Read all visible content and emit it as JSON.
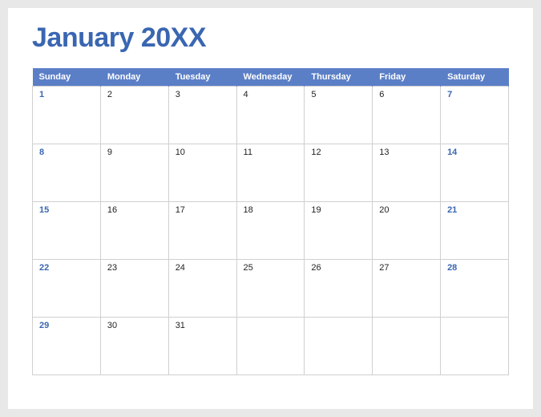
{
  "title": "January 20XX",
  "day_headers": [
    "Sunday",
    "Monday",
    "Tuesday",
    "Wednesday",
    "Thursday",
    "Friday",
    "Saturday"
  ],
  "weeks": [
    [
      {
        "n": "1",
        "weekend": true
      },
      {
        "n": "2",
        "weekend": false
      },
      {
        "n": "3",
        "weekend": false
      },
      {
        "n": "4",
        "weekend": false
      },
      {
        "n": "5",
        "weekend": false
      },
      {
        "n": "6",
        "weekend": false
      },
      {
        "n": "7",
        "weekend": true
      }
    ],
    [
      {
        "n": "8",
        "weekend": true
      },
      {
        "n": "9",
        "weekend": false
      },
      {
        "n": "10",
        "weekend": false
      },
      {
        "n": "11",
        "weekend": false
      },
      {
        "n": "12",
        "weekend": false
      },
      {
        "n": "13",
        "weekend": false
      },
      {
        "n": "14",
        "weekend": true
      }
    ],
    [
      {
        "n": "15",
        "weekend": true
      },
      {
        "n": "16",
        "weekend": false
      },
      {
        "n": "17",
        "weekend": false
      },
      {
        "n": "18",
        "weekend": false
      },
      {
        "n": "19",
        "weekend": false
      },
      {
        "n": "20",
        "weekend": false
      },
      {
        "n": "21",
        "weekend": true
      }
    ],
    [
      {
        "n": "22",
        "weekend": true
      },
      {
        "n": "23",
        "weekend": false
      },
      {
        "n": "24",
        "weekend": false
      },
      {
        "n": "25",
        "weekend": false
      },
      {
        "n": "26",
        "weekend": false
      },
      {
        "n": "27",
        "weekend": false
      },
      {
        "n": "28",
        "weekend": true
      }
    ],
    [
      {
        "n": "29",
        "weekend": true
      },
      {
        "n": "30",
        "weekend": false
      },
      {
        "n": "31",
        "weekend": false
      },
      {
        "n": "",
        "weekend": false
      },
      {
        "n": "",
        "weekend": false
      },
      {
        "n": "",
        "weekend": false
      },
      {
        "n": "",
        "weekend": true
      }
    ]
  ]
}
